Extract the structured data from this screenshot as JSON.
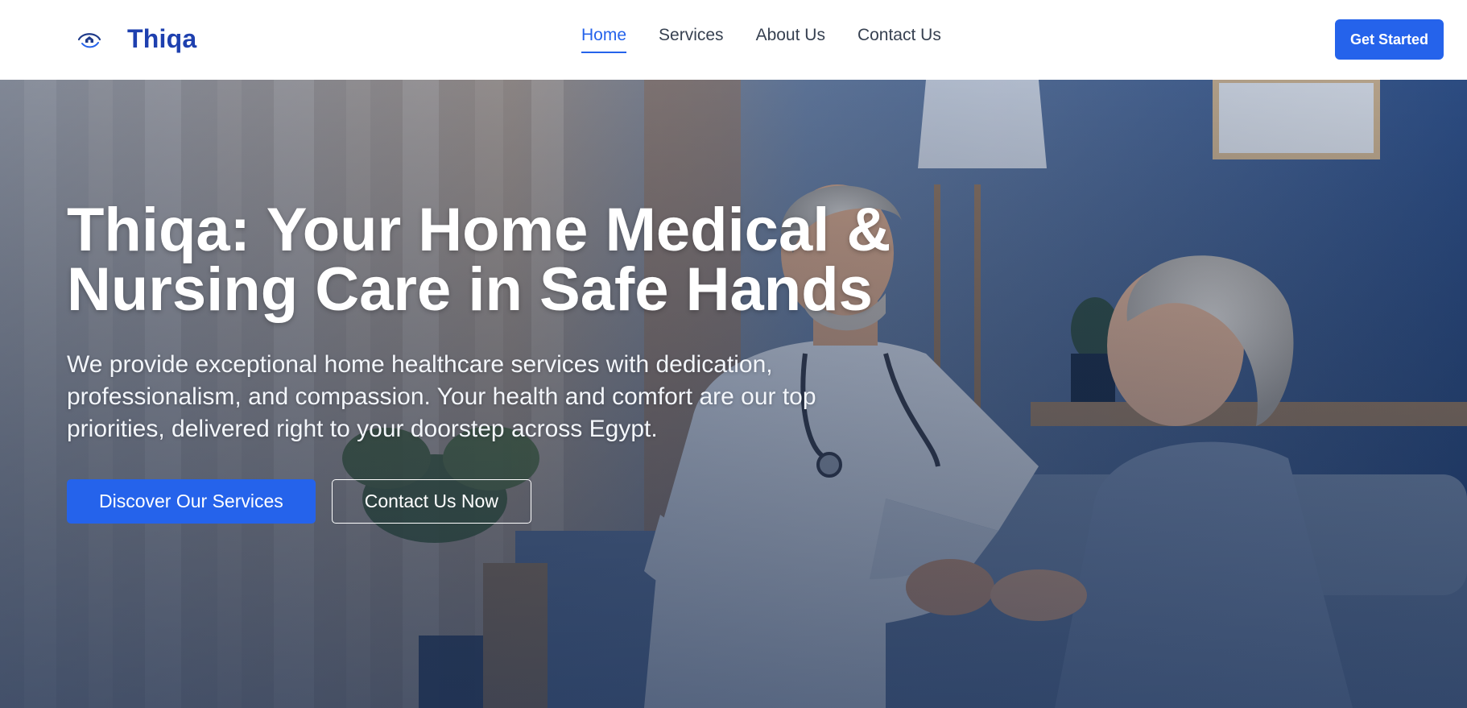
{
  "brand": {
    "name": "Thiqa",
    "logo_icon": "eye-house-logo-icon",
    "color": "#1e40af"
  },
  "nav": {
    "items": [
      {
        "label": "Home",
        "active": true
      },
      {
        "label": "Services",
        "active": false
      },
      {
        "label": "About Us",
        "active": false
      },
      {
        "label": "Contact Us",
        "active": false
      }
    ],
    "active_color": "#2563eb"
  },
  "header_cta": {
    "label": "Get Started",
    "color": "#2563eb"
  },
  "hero": {
    "title_line1": "Thiqa: Your Home Medical &",
    "title_line2": "Nursing Care in Safe Hands",
    "subtitle": "We provide exceptional home healthcare services with dedication, professionalism, and compassion. Your health and comfort are our top priorities, delivered right to your doorstep across Egypt.",
    "primary_button": "Discover Our Services",
    "secondary_button": "Contact Us Now",
    "image": "caregiver-with-elderly-woman-photo"
  }
}
